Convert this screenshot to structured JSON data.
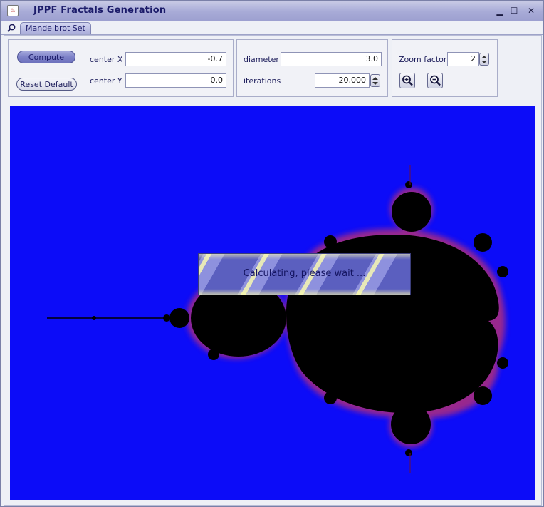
{
  "window": {
    "title": "JPPF Fractals Generation",
    "controls": {
      "minimize": "▁",
      "maximize": "☐",
      "close": "✕"
    }
  },
  "tabs": [
    {
      "label": "Mandelbrot Set",
      "icon": "search-icon"
    }
  ],
  "actions": {
    "compute_label": "Compute",
    "reset_label": "Reset Default"
  },
  "center": {
    "x_label": "center X",
    "x_value": "-0.7",
    "y_label": "center Y",
    "y_value": "0.0"
  },
  "params": {
    "diameter_label": "diameter",
    "diameter_value": "3.0",
    "iterations_label": "iterations",
    "iterations_value": "20,000"
  },
  "zoom": {
    "factor_label": "Zoom factor",
    "factor_value": "2",
    "zoom_in_icon": "zoom-in-icon",
    "zoom_out_icon": "zoom-out-icon"
  },
  "status": {
    "message": "Calculating, please wait ..."
  },
  "colors": {
    "canvas_background": "#0c0cf8",
    "set_color": "#000000",
    "edge_color": "#c8306a",
    "accent": "#7e82c8"
  }
}
